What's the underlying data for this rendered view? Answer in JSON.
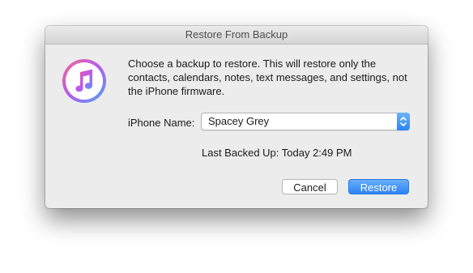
{
  "window": {
    "title": "Restore From Backup"
  },
  "app_icon": {
    "icon": "itunes-music-note-icon",
    "colors": [
      "#f0598c",
      "#ba59f1",
      "#47a7f2"
    ]
  },
  "message": "Choose a backup to restore. This will restore only the contacts, calendars, notes, text messages, and settings, not the iPhone firmware.",
  "iphone_name": {
    "label": "iPhone Name:",
    "selected": "Spacey Grey"
  },
  "last_backed_up": "Last Backed Up: Today 2:49 PM",
  "buttons": {
    "cancel": "Cancel",
    "restore": "Restore"
  },
  "accent_color": "#2b84f4"
}
